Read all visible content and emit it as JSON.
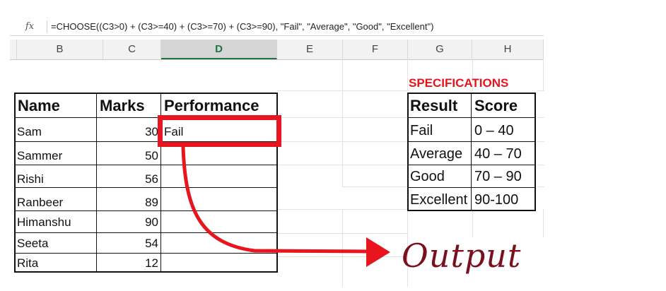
{
  "formula_bar": {
    "icon": "fx",
    "formula": "=CHOOSE((C3>0) + (C3>=40) + (C3>=70) + (C3>=90), \"Fail\", \"Average\", \"Good\", \"Excellent\")"
  },
  "columns": [
    "B",
    "C",
    "D",
    "E",
    "F",
    "G",
    "H"
  ],
  "selected_column": "D",
  "main_table": {
    "headers": {
      "name": "Name",
      "marks": "Marks",
      "performance": "Performance"
    },
    "rows": [
      {
        "name": "Sam",
        "marks": "30",
        "performance": "Fail"
      },
      {
        "name": "Sammer",
        "marks": "50",
        "performance": ""
      },
      {
        "name": "Rishi",
        "marks": "56",
        "performance": ""
      },
      {
        "name": "Ranbeer",
        "marks": "89",
        "performance": ""
      },
      {
        "name": "Himanshu",
        "marks": "90",
        "performance": ""
      },
      {
        "name": "Seeta",
        "marks": "54",
        "performance": ""
      },
      {
        "name": "Rita",
        "marks": "12",
        "performance": ""
      }
    ]
  },
  "spec_table": {
    "title": "SPECIFICATIONS",
    "headers": {
      "result": "Result",
      "score": "Score"
    },
    "rows": [
      {
        "result": "Fail",
        "score": "0 – 40"
      },
      {
        "result": "Average",
        "score": "40 – 70"
      },
      {
        "result": "Good",
        "score": "70 – 90"
      },
      {
        "result": "Excellent",
        "score": "90-100"
      }
    ]
  },
  "annotation": {
    "label": "Output"
  },
  "colors": {
    "highlight": "#e8141e",
    "spec_title": "#e6141b",
    "output_label": "#7a0f1e",
    "selected_column": "#217346"
  }
}
